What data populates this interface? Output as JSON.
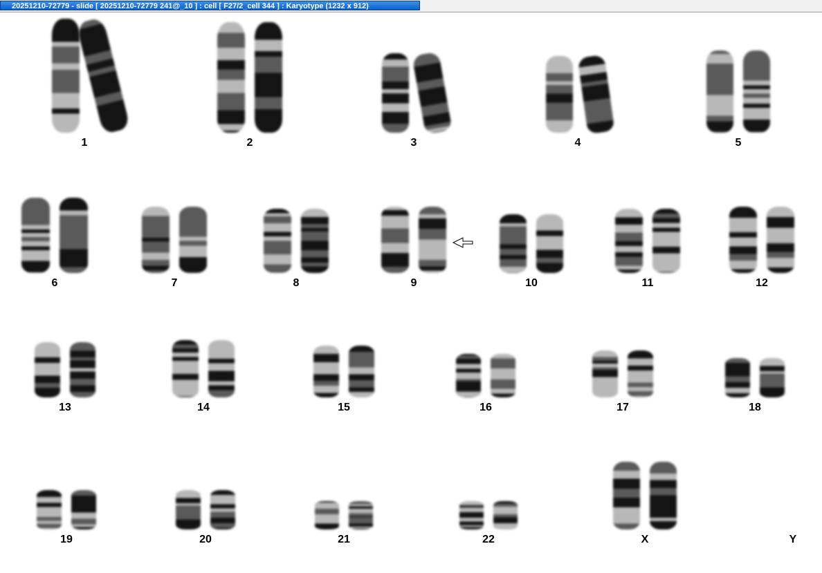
{
  "window": {
    "title": "20251210-72779 - slide [ 20251210-72779 241@_10 ] : cell [ F27/2_cell 344 ] : Karyotype  (1232 x 912)"
  },
  "karyotype": {
    "rows": [
      {
        "pairs": [
          {
            "label": "1",
            "length": 1.0,
            "tilt": [
              0,
              -14
            ]
          },
          {
            "label": "2",
            "length": 0.97,
            "tilt": [
              0,
              0
            ]
          },
          {
            "label": "3",
            "length": 0.7,
            "tilt": [
              0,
              -10
            ]
          },
          {
            "label": "4",
            "length": 0.67,
            "tilt": [
              0,
              -8
            ]
          },
          {
            "label": "5",
            "length": 0.72,
            "tilt": [
              0,
              0
            ]
          }
        ]
      },
      {
        "pairs": [
          {
            "label": "6",
            "length": 0.7,
            "tilt": [
              0,
              0
            ]
          },
          {
            "label": "7",
            "length": 0.62,
            "tilt": [
              0,
              0
            ]
          },
          {
            "label": "8",
            "length": 0.6,
            "tilt": [
              0,
              0
            ]
          },
          {
            "label": "9",
            "length": 0.62,
            "tilt": [
              0,
              0
            ],
            "marker": "arrow-left"
          },
          {
            "label": "10",
            "length": 0.55,
            "tilt": [
              0,
              0
            ]
          },
          {
            "label": "11",
            "length": 0.6,
            "tilt": [
              0,
              0
            ]
          },
          {
            "label": "12",
            "length": 0.62,
            "tilt": [
              0,
              0
            ]
          }
        ]
      },
      {
        "pairs": [
          {
            "label": "13",
            "length": 0.53,
            "tilt": [
              0,
              0
            ]
          },
          {
            "label": "14",
            "length": 0.55,
            "tilt": [
              0,
              0
            ]
          },
          {
            "label": "15",
            "length": 0.5,
            "tilt": [
              0,
              0
            ]
          },
          {
            "label": "16",
            "length": 0.42,
            "tilt": [
              0,
              0
            ]
          },
          {
            "label": "17",
            "length": 0.45,
            "tilt": [
              0,
              0
            ]
          },
          {
            "label": "18",
            "length": 0.38,
            "tilt": [
              0,
              0
            ]
          }
        ]
      },
      {
        "pairs": [
          {
            "label": "19",
            "length": 0.38,
            "tilt": [
              0,
              0
            ]
          },
          {
            "label": "20",
            "length": 0.38,
            "tilt": [
              0,
              0
            ]
          },
          {
            "label": "21",
            "length": 0.27,
            "tilt": [
              0,
              0
            ]
          },
          {
            "label": "22",
            "length": 0.27,
            "tilt": [
              0,
              0
            ]
          },
          {
            "label": "X",
            "length": 0.65,
            "tilt": [
              0,
              0
            ]
          },
          {
            "label": "Y",
            "length": 0,
            "tilt": [
              0,
              0
            ]
          }
        ]
      }
    ]
  },
  "colors": {
    "title_gradient_top": "#3d8fe6",
    "title_gradient_bottom": "#0a62d0",
    "chromosome_dark": "#141414",
    "chromosome_light": "#b8b8b8"
  }
}
